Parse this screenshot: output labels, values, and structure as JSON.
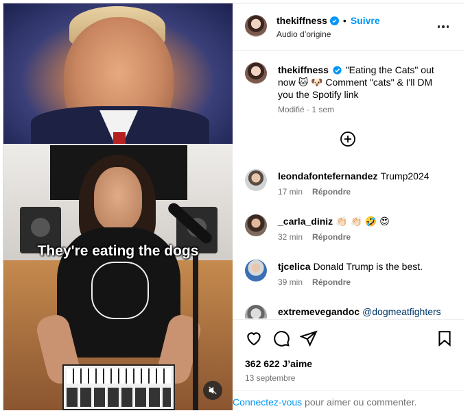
{
  "post": {
    "username": "thekiffness",
    "follow_label": "Suivre",
    "separator": "•",
    "audio": "Audio d’origine"
  },
  "media": {
    "caption_overlay": "They're eating the dogs"
  },
  "caption": {
    "username": "thekiffness",
    "text": "\"Eating the Cats\" out now 🐱 🐶 Comment \"cats\" & I'll DM you the Spotify link",
    "meta": "Modifié · 1 sem"
  },
  "comments": [
    {
      "username": "leondafontefernandez",
      "text": "Trump2024",
      "time": "17 min",
      "reply": "Répondre"
    },
    {
      "username": "_carla_diniz",
      "text": "👏🏻 👏🏻 🤣 😍",
      "time": "32 min",
      "reply": "Répondre"
    },
    {
      "username": "tjcelica",
      "text": "Donald Trump is the best.",
      "time": "39 min",
      "reply": "Répondre"
    },
    {
      "username": "extremevegandoc",
      "text": "@dogmeatfighters",
      "time": "",
      "reply": ""
    }
  ],
  "stats": {
    "likes": "362 622 J’aime",
    "date": "13 septembre"
  },
  "login": {
    "link": "Connectez-vous",
    "rest": " pour aimer ou commenter."
  },
  "icons": {
    "verified": "verified-badge-icon",
    "more": "more-options-icon",
    "add": "plus-circle-icon",
    "like": "heart-icon",
    "comment": "comment-icon",
    "share": "share-icon",
    "save": "bookmark-icon",
    "mute": "mute-icon"
  },
  "colors": {
    "accent": "#0095f6",
    "muted": "#737373",
    "border": "#efefef"
  }
}
